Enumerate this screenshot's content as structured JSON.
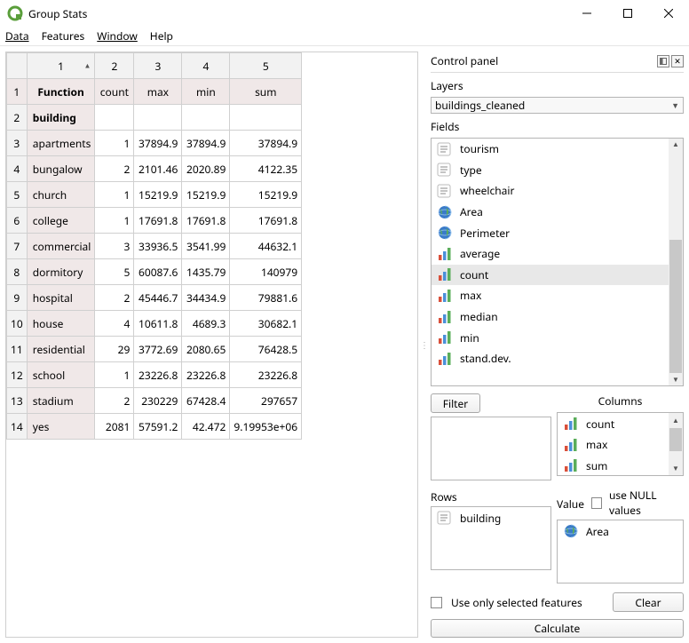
{
  "title": "Group Stats",
  "menu": {
    "data": "Data",
    "features": "Features",
    "window": "Window",
    "help": "Help"
  },
  "table": {
    "topHeaders": [
      "1",
      "2",
      "3",
      "4",
      "5"
    ],
    "funcLabel": "Function",
    "funcHeaders": [
      "count",
      "max",
      "min",
      "sum"
    ],
    "rows": [
      {
        "n": "1",
        "isHeader": false
      },
      {
        "n": "2",
        "cat": "building",
        "count": "",
        "max": "",
        "min": "",
        "sum": "",
        "isHeader": true
      },
      {
        "n": "3",
        "cat": "apartments",
        "count": "1",
        "max": "37894.9",
        "min": "37894.9",
        "sum": "37894.9"
      },
      {
        "n": "4",
        "cat": "bungalow",
        "count": "2",
        "max": "2101.46",
        "min": "2020.89",
        "sum": "4122.35"
      },
      {
        "n": "5",
        "cat": "church",
        "count": "1",
        "max": "15219.9",
        "min": "15219.9",
        "sum": "15219.9"
      },
      {
        "n": "6",
        "cat": "college",
        "count": "1",
        "max": "17691.8",
        "min": "17691.8",
        "sum": "17691.8"
      },
      {
        "n": "7",
        "cat": "commercial",
        "count": "3",
        "max": "33936.5",
        "min": "3541.99",
        "sum": "44632.1"
      },
      {
        "n": "8",
        "cat": "dormitory",
        "count": "5",
        "max": "60087.6",
        "min": "1435.79",
        "sum": "140979"
      },
      {
        "n": "9",
        "cat": "hospital",
        "count": "2",
        "max": "45446.7",
        "min": "34434.9",
        "sum": "79881.6"
      },
      {
        "n": "10",
        "cat": "house",
        "count": "4",
        "max": "10611.8",
        "min": "4689.3",
        "sum": "30682.1"
      },
      {
        "n": "11",
        "cat": "residential",
        "count": "29",
        "max": "3772.69",
        "min": "2080.65",
        "sum": "76428.5"
      },
      {
        "n": "12",
        "cat": "school",
        "count": "1",
        "max": "23226.8",
        "min": "23226.8",
        "sum": "23226.8"
      },
      {
        "n": "13",
        "cat": "stadium",
        "count": "2",
        "max": "230229",
        "min": "67428.4",
        "sum": "297657"
      },
      {
        "n": "14",
        "cat": "yes",
        "count": "2081",
        "max": "57591.2",
        "min": "42.472",
        "sum": "9.19953e+06"
      }
    ]
  },
  "panel": {
    "title": "Control panel",
    "layersLabel": "Layers",
    "layerValue": "buildings_cleaned",
    "fieldsLabel": "Fields",
    "fields": [
      {
        "icon": "text",
        "label": "tourism"
      },
      {
        "icon": "text",
        "label": "type"
      },
      {
        "icon": "text",
        "label": "wheelchair"
      },
      {
        "icon": "globe",
        "label": "Area"
      },
      {
        "icon": "globe",
        "label": "Perimeter"
      },
      {
        "icon": "bars",
        "label": "average"
      },
      {
        "icon": "bars",
        "label": "count",
        "selected": true
      },
      {
        "icon": "bars",
        "label": "max"
      },
      {
        "icon": "bars",
        "label": "median"
      },
      {
        "icon": "bars",
        "label": "min"
      },
      {
        "icon": "bars",
        "label": "stand.dev."
      }
    ],
    "filterLabel": "Filter",
    "columnsLabel": "Columns",
    "columnsItems": [
      {
        "icon": "bars",
        "label": "count"
      },
      {
        "icon": "bars",
        "label": "max"
      },
      {
        "icon": "bars",
        "label": "sum"
      }
    ],
    "rowsLabel": "Rows",
    "rowsItems": [
      {
        "icon": "text",
        "label": "building"
      }
    ],
    "valueLabel": "Value",
    "useNull": "use NULL values",
    "valueItems": [
      {
        "icon": "globe",
        "label": "Area"
      }
    ],
    "useOnlySelected": "Use only selected features",
    "clear": "Clear",
    "calculate": "Calculate"
  },
  "chart_data": {
    "type": "table",
    "title": "Group Stats",
    "row_field": "building",
    "value_field": "Area",
    "columns": [
      "count",
      "max",
      "min",
      "sum"
    ],
    "rows": [
      {
        "building": "apartments",
        "count": 1,
        "max": 37894.9,
        "min": 37894.9,
        "sum": 37894.9
      },
      {
        "building": "bungalow",
        "count": 2,
        "max": 2101.46,
        "min": 2020.89,
        "sum": 4122.35
      },
      {
        "building": "church",
        "count": 1,
        "max": 15219.9,
        "min": 15219.9,
        "sum": 15219.9
      },
      {
        "building": "college",
        "count": 1,
        "max": 17691.8,
        "min": 17691.8,
        "sum": 17691.8
      },
      {
        "building": "commercial",
        "count": 3,
        "max": 33936.5,
        "min": 3541.99,
        "sum": 44632.1
      },
      {
        "building": "dormitory",
        "count": 5,
        "max": 60087.6,
        "min": 1435.79,
        "sum": 140979
      },
      {
        "building": "hospital",
        "count": 2,
        "max": 45446.7,
        "min": 34434.9,
        "sum": 79881.6
      },
      {
        "building": "house",
        "count": 4,
        "max": 10611.8,
        "min": 4689.3,
        "sum": 30682.1
      },
      {
        "building": "residential",
        "count": 29,
        "max": 3772.69,
        "min": 2080.65,
        "sum": 76428.5
      },
      {
        "building": "school",
        "count": 1,
        "max": 23226.8,
        "min": 23226.8,
        "sum": 23226.8
      },
      {
        "building": "stadium",
        "count": 2,
        "max": 230229,
        "min": 67428.4,
        "sum": 297657
      },
      {
        "building": "yes",
        "count": 2081,
        "max": 57591.2,
        "min": 42.472,
        "sum": 9199530
      }
    ]
  }
}
